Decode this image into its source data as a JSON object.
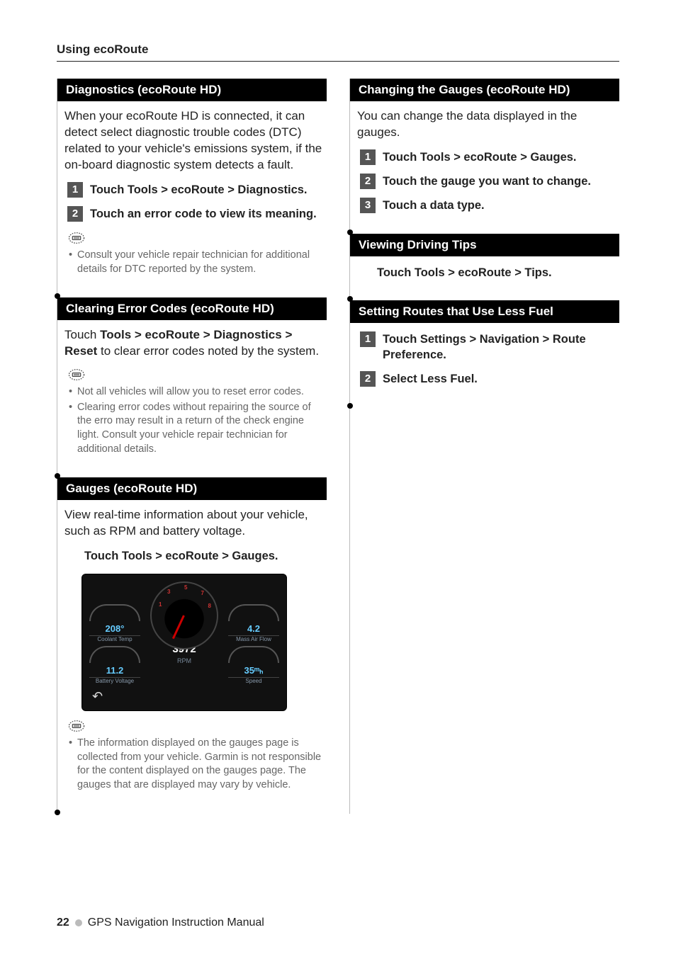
{
  "page_header": "Using ecoRoute",
  "footer": {
    "page": "22",
    "title": "GPS Navigation Instruction Manual"
  },
  "left": {
    "diag": {
      "title": "Diagnostics (ecoRoute HD)",
      "intro": "When your ecoRoute HD is connected, it can detect select diagnostic trouble codes (DTC) related to your vehicle's emissions system, if the on-board diagnostic system detects a fault.",
      "steps": [
        "Touch Tools > ecoRoute > Diagnostics.",
        "Touch an error code to view its meaning."
      ],
      "notes": [
        "Consult your vehicle repair technician for additional details for DTC reported by the system."
      ]
    },
    "clear": {
      "title": "Clearing Error Codes (ecoRoute HD)",
      "body_pre": "Touch ",
      "body_bold": "Tools > ecoRoute > Diagnostics > Reset",
      "body_post": " to clear error codes noted by the system.",
      "notes": [
        "Not all vehicles will allow you to reset error codes.",
        "Clearing error codes without repairing the source of the erro may result in a return of the check engine light. Consult your vehicle repair technician for additional details."
      ]
    },
    "gauges": {
      "title": "Gauges (ecoRoute HD)",
      "intro": "View real-time information about your vehicle, such as RPM and battery voltage.",
      "step": "Touch Tools > ecoRoute > Gauges.",
      "screenshot": {
        "coolant": {
          "value": "208°",
          "label": "Coolant Temp"
        },
        "massair": {
          "value": "4.2",
          "label": "Mass Air Flow"
        },
        "battery": {
          "value": "11.2",
          "label": "Battery Voltage"
        },
        "speed": {
          "value": "35ᵐₕ",
          "label": "Speed"
        },
        "rpm": {
          "value": "3972",
          "label": "RPM"
        }
      },
      "notes": [
        "The information displayed on the gauges page is collected from your vehicle. Garmin is not responsible for the content displayed on the gauges page. The gauges that are displayed may vary by vehicle."
      ]
    }
  },
  "right": {
    "changing": {
      "title": "Changing the Gauges (ecoRoute HD)",
      "intro": "You can change the data displayed in the gauges.",
      "steps": [
        "Touch Tools > ecoRoute > Gauges.",
        "Touch the gauge you want to change.",
        "Touch a data type."
      ]
    },
    "tips": {
      "title": "Viewing Driving Tips",
      "step": "Touch Tools > ecoRoute > Tips."
    },
    "fuel": {
      "title": "Setting Routes that Use Less Fuel",
      "steps": [
        "Touch Settings > Navigation > Route Preference.",
        "Select Less Fuel."
      ]
    }
  }
}
